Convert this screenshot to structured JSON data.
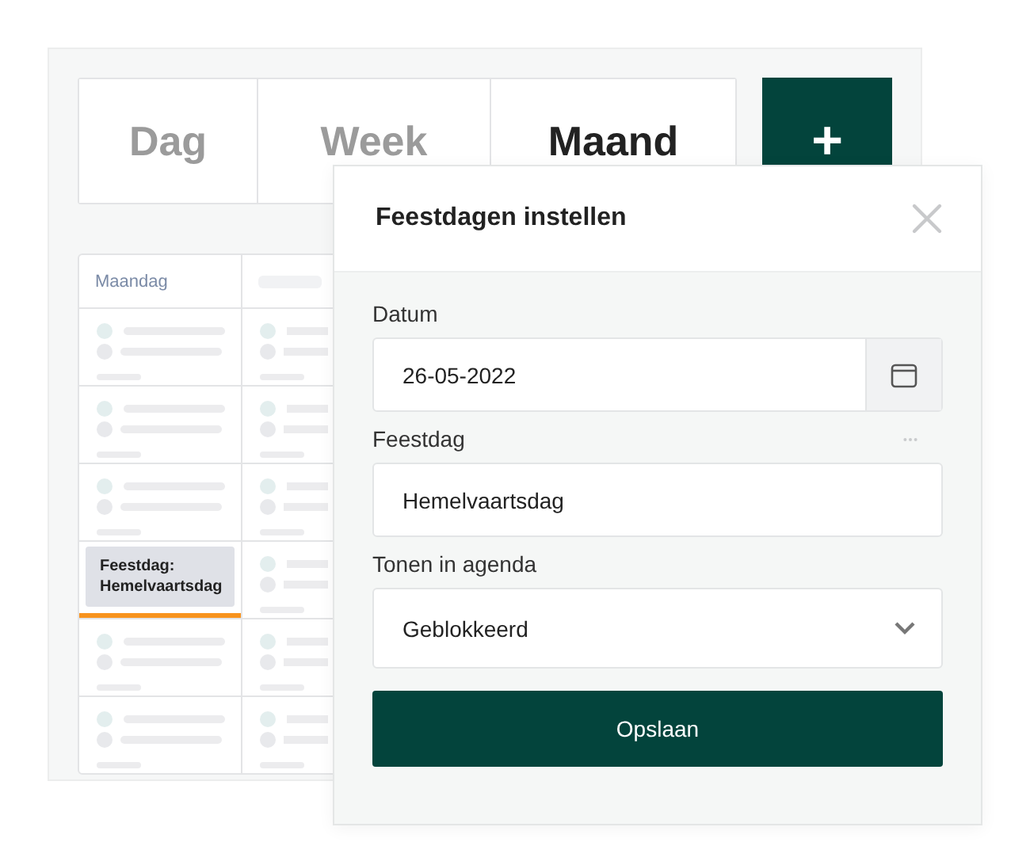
{
  "tabs": [
    {
      "label": "Dag",
      "selected": false
    },
    {
      "label": "Week",
      "selected": false
    },
    {
      "label": "Maand",
      "selected": true
    }
  ],
  "add_button": {
    "label": "+"
  },
  "calendar": {
    "columns": [
      {
        "kind": "label",
        "label": "Maandag"
      },
      {
        "kind": "skeleton"
      }
    ],
    "rows": [
      {
        "cells": [
          {
            "kind": "skeleton"
          },
          {
            "kind": "skeleton"
          }
        ]
      },
      {
        "cells": [
          {
            "kind": "skeleton"
          },
          {
            "kind": "skeleton"
          }
        ]
      },
      {
        "cells": [
          {
            "kind": "skeleton"
          },
          {
            "kind": "skeleton"
          }
        ]
      },
      {
        "cells": [
          {
            "kind": "event",
            "label": "Feestdag: Hemelvaartsdag",
            "color": "#f7931e"
          },
          {
            "kind": "skeleton"
          }
        ]
      },
      {
        "cells": [
          {
            "kind": "skeleton"
          },
          {
            "kind": "skeleton"
          }
        ]
      },
      {
        "cells": [
          {
            "kind": "skeleton"
          },
          {
            "kind": "skeleton"
          }
        ]
      }
    ]
  },
  "dialog": {
    "title": "Feestdagen instellen",
    "fields": [
      {
        "kind": "date",
        "label": "Datum",
        "value": "26-05-2022"
      },
      {
        "kind": "text",
        "label": "Feestdag",
        "value": "Hemelvaartsdag"
      },
      {
        "kind": "select",
        "label": "Tonen in agenda",
        "value": "Geblokkeerd"
      }
    ],
    "save_button": "Opslaan"
  }
}
